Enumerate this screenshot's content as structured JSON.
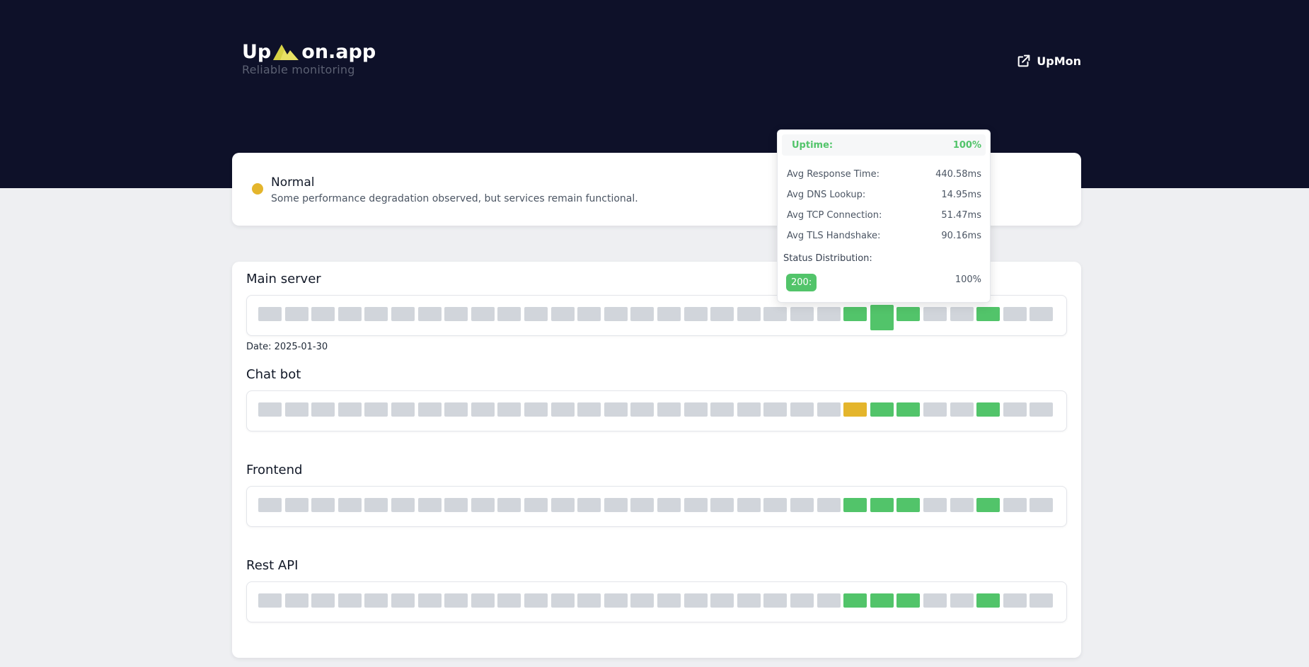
{
  "brand": {
    "logo_left": "Up",
    "logo_right": "on.app",
    "tagline": "Reliable monitoring",
    "icon": "mountain-logo-icon"
  },
  "header": {
    "link_label": "UpMon",
    "link_icon": "external-link-icon"
  },
  "status": {
    "title": "Normal",
    "description": "Some performance degradation observed, but services remain functional.",
    "color": "#e4b52c"
  },
  "colors": {
    "up": "#52c46a",
    "degraded": "#e4b52c",
    "nodata": "#d1d5db",
    "hero": "#0e1129"
  },
  "monitors": [
    {
      "name": "Main server",
      "date_label": "Date: 2025-01-30",
      "selected_index": 23,
      "bars": [
        "nodata",
        "nodata",
        "nodata",
        "nodata",
        "nodata",
        "nodata",
        "nodata",
        "nodata",
        "nodata",
        "nodata",
        "nodata",
        "nodata",
        "nodata",
        "nodata",
        "nodata",
        "nodata",
        "nodata",
        "nodata",
        "nodata",
        "nodata",
        "nodata",
        "nodata",
        "up",
        "up",
        "up",
        "nodata",
        "nodata",
        "up",
        "nodata",
        "nodata"
      ]
    },
    {
      "name": "Chat bot",
      "date_label": "",
      "bars": [
        "nodata",
        "nodata",
        "nodata",
        "nodata",
        "nodata",
        "nodata",
        "nodata",
        "nodata",
        "nodata",
        "nodata",
        "nodata",
        "nodata",
        "nodata",
        "nodata",
        "nodata",
        "nodata",
        "nodata",
        "nodata",
        "nodata",
        "nodata",
        "nodata",
        "nodata",
        "degraded",
        "up",
        "up",
        "nodata",
        "nodata",
        "up",
        "nodata",
        "nodata"
      ]
    },
    {
      "name": "Frontend",
      "date_label": "",
      "bars": [
        "nodata",
        "nodata",
        "nodata",
        "nodata",
        "nodata",
        "nodata",
        "nodata",
        "nodata",
        "nodata",
        "nodata",
        "nodata",
        "nodata",
        "nodata",
        "nodata",
        "nodata",
        "nodata",
        "nodata",
        "nodata",
        "nodata",
        "nodata",
        "nodata",
        "nodata",
        "up",
        "up",
        "up",
        "nodata",
        "nodata",
        "up",
        "nodata",
        "nodata"
      ]
    },
    {
      "name": "Rest API",
      "date_label": "",
      "bars": [
        "nodata",
        "nodata",
        "nodata",
        "nodata",
        "nodata",
        "nodata",
        "nodata",
        "nodata",
        "nodata",
        "nodata",
        "nodata",
        "nodata",
        "nodata",
        "nodata",
        "nodata",
        "nodata",
        "nodata",
        "nodata",
        "nodata",
        "nodata",
        "nodata",
        "nodata",
        "up",
        "up",
        "up",
        "nodata",
        "nodata",
        "up",
        "nodata",
        "nodata"
      ]
    }
  ],
  "tooltip": {
    "uptime_label": "Uptime:",
    "uptime_value": "100%",
    "rows": [
      {
        "label": "Avg Response Time:",
        "value": "440.58ms"
      },
      {
        "label": "Avg DNS Lookup:",
        "value": "14.95ms"
      },
      {
        "label": "Avg TCP Connection:",
        "value": "51.47ms"
      },
      {
        "label": "Avg TLS Handshake:",
        "value": "90.16ms"
      }
    ],
    "distribution_label": "Status Distribution:",
    "badge": "200:",
    "badge_value": "100%"
  }
}
